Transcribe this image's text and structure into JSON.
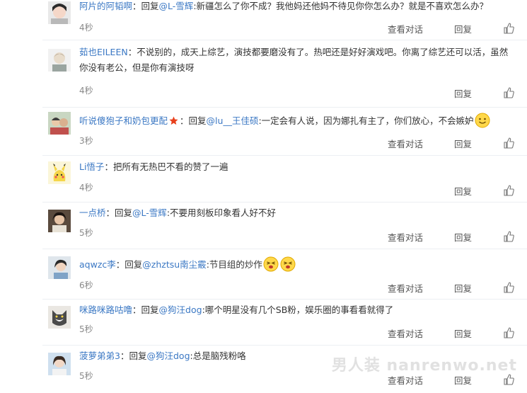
{
  "actions": {
    "view_dialog": "查看对话",
    "reply": "回复"
  },
  "comments": [
    {
      "user": "阿片的阿韬啊",
      "sep": "：",
      "reply_prefix": "回复",
      "at": "@L-雪辉",
      "text": ":新疆怎么了你不成？我他妈还他妈不待见你你怎么办？就是不喜欢怎么办？",
      "time": "4秒"
    },
    {
      "user": "茹也EILEEN",
      "sep": "：",
      "text": "不说别的，成天上综艺，演技都要磨没有了。热吧还是好好演戏吧。你离了综艺还可以活，虽然你没有老公，但是你有演技呀",
      "time": "4秒"
    },
    {
      "user": "听说傻狍子和奶包更配",
      "sep": "：",
      "reply_prefix": "回复",
      "at": "@lu__王佳硕",
      "text": ":一定会有人说，因为娜扎有主了，你们放心，不会嫉妒",
      "time": "3秒"
    },
    {
      "user": "Li悟子",
      "sep": "：",
      "text": "把所有无热巴不看的赞了一遍",
      "time": "4秒"
    },
    {
      "user": "一点桥",
      "sep": "：",
      "reply_prefix": "回复",
      "at": "@L-雪辉",
      "text": ":不要用刻板印象看人好不好",
      "time": "5秒"
    },
    {
      "user": "aqwzc李",
      "sep": "：",
      "reply_prefix": "回复",
      "at": "@zhztsu南尘霰",
      "text": ":节目组的炒作",
      "time": "6秒"
    },
    {
      "user": "咪路咪路咕噜",
      "sep": "：",
      "reply_prefix": "回复",
      "at": "@狗汪dog",
      "text": ":哪个明星没有几个SB粉，娱乐圈的事看看就得了",
      "time": "5秒"
    },
    {
      "user": "菠萝弟弟3",
      "sep": "：",
      "reply_prefix": "回复",
      "at": "@狗汪dog",
      "text": ":总是脑残粉咯",
      "time": "5秒"
    }
  ],
  "watermark": "男人装 nanrenwo.net"
}
